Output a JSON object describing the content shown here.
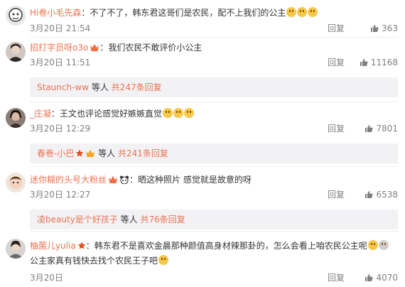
{
  "comments": [
    {
      "username": "Hi卷小毛先森",
      "text": "不了不了，韩东君这哥们是农民，配不上我们的公主",
      "date": "3月20日 21:54",
      "reply_label": "回复",
      "likes": "363",
      "avatar_icon": "cartoon-face-avatar"
    },
    {
      "username": "招打字员呀o3o",
      "text": "我们农民不敢评价小公主",
      "date": "3月20日 11:51",
      "reply_label": "回复",
      "likes": "11168",
      "replies": {
        "names": "Staunch-ww",
        "suffix": "等人",
        "count": "共247条回复"
      },
      "avatar_icon": "photo-avatar"
    },
    {
      "username": "_庄凝",
      "text": "王文也评论感觉好嫉嫉直觉",
      "date": "3月20日 12:29",
      "reply_label": "回复",
      "likes": "7801",
      "replies": {
        "names": "春卷-小巴",
        "suffix": "等人",
        "count": "共241条回复"
      },
      "avatar_icon": "photo-avatar"
    },
    {
      "username": "迷你糊的头号大粉丝",
      "text": "晒这种照片 感觉就是故意的呀",
      "date": "3月20日 12:27",
      "reply_label": "回复",
      "likes": "6538",
      "replies": {
        "names": "凌beauty是个好孩子",
        "suffix": "等人",
        "count": "共76条回复"
      },
      "avatar_icon": "baby-photo-avatar"
    },
    {
      "username": "柚菌儿yulia",
      "text": "韩东君不是喜欢金晨那种颜值高身材辣那卦的，怎么会看上咱农民公主呢",
      "text2": "公主家真有钱快去找个农民王子吧",
      "date": "3月20日",
      "reply_label": "回复",
      "likes": "4070",
      "avatar_icon": "photo-avatar"
    }
  ],
  "colors": {
    "username": "#eb7350",
    "meta": "#808080",
    "reply_bg": "#f2f2f5"
  }
}
